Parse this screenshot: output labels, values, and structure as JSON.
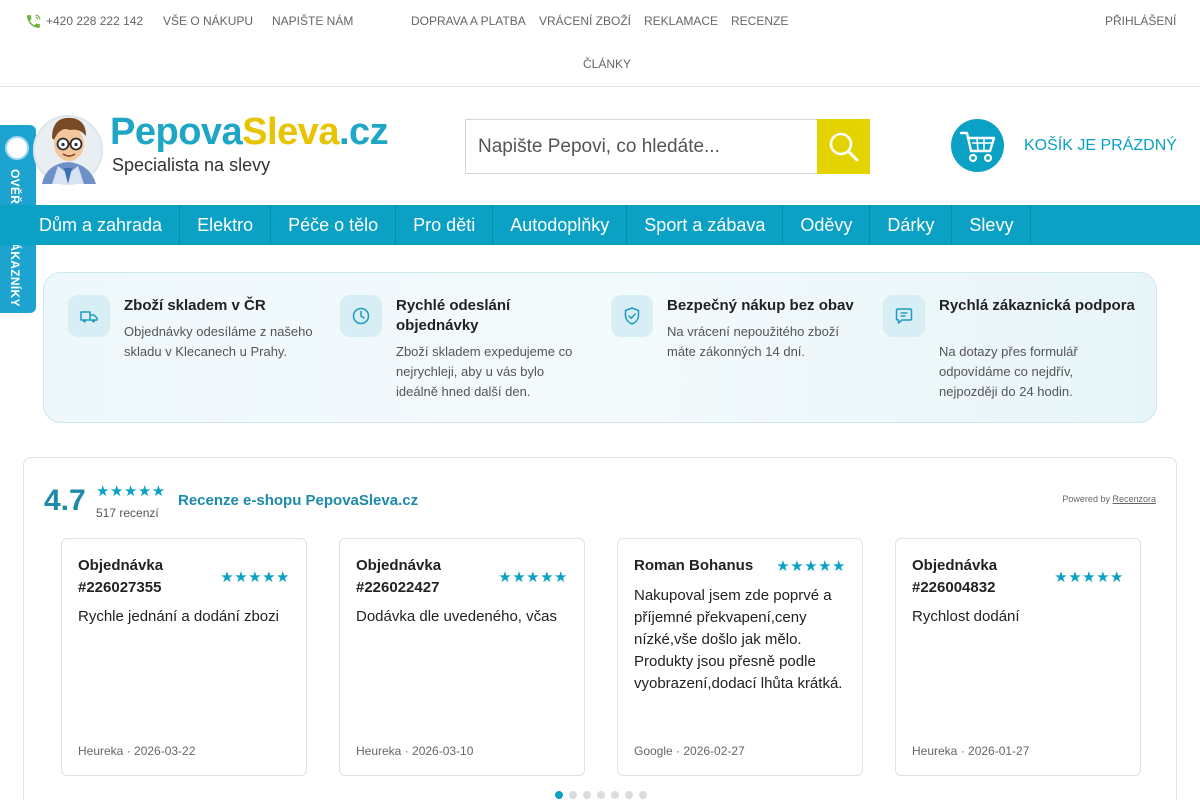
{
  "topbar": {
    "phone": "+420 228 222 142",
    "links": [
      "VŠE O NÁKUPU",
      "NAPIŠTE NÁM",
      "DOPRAVA A PLATBA",
      "VRÁCENÍ ZBOŽÍ",
      "REKLAMACE",
      "RECENZE",
      "ČLÁNKY"
    ],
    "login": "PŘIHLÁŠENÍ"
  },
  "logo": {
    "part1": "Pepova",
    "part2": "Sleva",
    "part3": ".cz",
    "tagline": "Specialista na slevy"
  },
  "search": {
    "placeholder": "Napište Pepovi, co hledáte..."
  },
  "cart": {
    "label": "KOŠÍK JE PRÁZDNÝ"
  },
  "nav": [
    "Dům a zahrada",
    "Elektro",
    "Péče o tělo",
    "Pro děti",
    "Autodoplňky",
    "Sport a zábava",
    "Oděvy",
    "Dárky",
    "Slevy"
  ],
  "side_badge": {
    "text": "OVĚŘENO ZÁKAZNÍKY"
  },
  "benefits": [
    {
      "title": "Zboží skladem v ČR",
      "lines": [
        "Objednávky odesíláme z našeho",
        "skladu v Klecanech u Prahy."
      ],
      "icon": "truck-icon"
    },
    {
      "title": "Rychlé odeslání objednávky",
      "lines": [
        "Zboží skladem expedujeme co",
        "nejrychleji, aby u vás bylo",
        "ideálně hned další den."
      ],
      "icon": "clock-icon"
    },
    {
      "title": "Bezpečný nákup bez obav",
      "lines": [
        "Na vrácení nepoužitého zboží",
        "máte zákonných 14 dní."
      ],
      "icon": "shield-check-icon"
    },
    {
      "title": "Rychlá zákaznická podpora",
      "lines": [
        "Na dotazy přes formulář",
        "odpovídáme co nejdřív,",
        "nejpozději do 24 hodin."
      ],
      "icon": "chat-icon"
    }
  ],
  "reviews": {
    "rating": "4.7",
    "stars": "★★★★★",
    "count": "517 recenzí",
    "title": "Recenze e-shopu PepovaSleva.cz",
    "powered_prefix": "Powered by",
    "powered_link": "Recenzora",
    "cards": [
      {
        "head_lines": [
          "Objednávka",
          "#226027355"
        ],
        "stars": "★★★★★",
        "text_lines": [
          "Rychle jednání a dodání zbozi"
        ],
        "source": "Heureka · 2026-03-22"
      },
      {
        "head_lines": [
          "Objednávka",
          "#226022427"
        ],
        "stars": "★★★★★",
        "text_lines": [
          "Dodávka dle uvedeného, včas"
        ],
        "source": "Heureka · 2026-03-10"
      },
      {
        "head_lines": [
          "Roman Bohanus"
        ],
        "stars": "★★★★★",
        "text_lines": [
          "Nakupoval jsem zde poprvé a",
          "příjemné překvapení,ceny",
          "nízké,vše došlo jak mělo.",
          "Produkty jsou přesně podle",
          "vyobrazení,dodací lhůta krátká."
        ],
        "source": "Google · 2026-02-27"
      },
      {
        "head_lines": [
          "Objednávka",
          "#226004832"
        ],
        "stars": "★★★★★",
        "text_lines": [
          "Rychlost dodání"
        ],
        "source": "Heureka · 2026-01-27"
      }
    ]
  },
  "colors": {
    "accent": "#0aa1c4",
    "search_button": "#e3d400",
    "logo_blue": "#1ea6c6",
    "logo_yellow": "#e8c400"
  }
}
